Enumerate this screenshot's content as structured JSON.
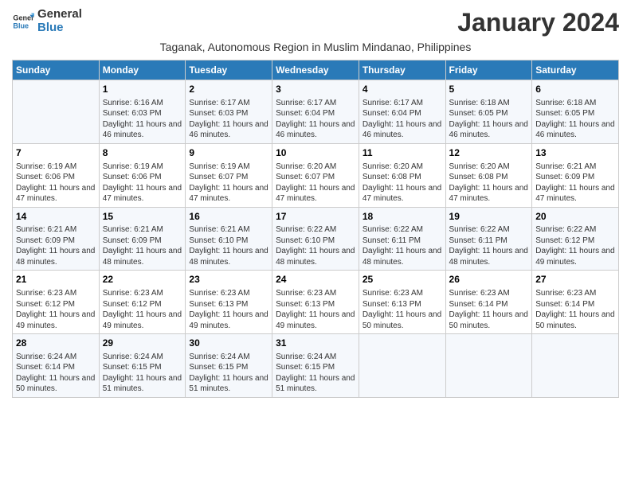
{
  "logo": {
    "line1": "General",
    "line2": "Blue"
  },
  "month_title": "January 2024",
  "subtitle": "Taganak, Autonomous Region in Muslim Mindanao, Philippines",
  "days_of_week": [
    "Sunday",
    "Monday",
    "Tuesday",
    "Wednesday",
    "Thursday",
    "Friday",
    "Saturday"
  ],
  "weeks": [
    [
      {
        "day": "",
        "info": ""
      },
      {
        "day": "1",
        "info": "Sunrise: 6:16 AM\nSunset: 6:03 PM\nDaylight: 11 hours and 46 minutes."
      },
      {
        "day": "2",
        "info": "Sunrise: 6:17 AM\nSunset: 6:03 PM\nDaylight: 11 hours and 46 minutes."
      },
      {
        "day": "3",
        "info": "Sunrise: 6:17 AM\nSunset: 6:04 PM\nDaylight: 11 hours and 46 minutes."
      },
      {
        "day": "4",
        "info": "Sunrise: 6:17 AM\nSunset: 6:04 PM\nDaylight: 11 hours and 46 minutes."
      },
      {
        "day": "5",
        "info": "Sunrise: 6:18 AM\nSunset: 6:05 PM\nDaylight: 11 hours and 46 minutes."
      },
      {
        "day": "6",
        "info": "Sunrise: 6:18 AM\nSunset: 6:05 PM\nDaylight: 11 hours and 46 minutes."
      }
    ],
    [
      {
        "day": "7",
        "info": "Sunrise: 6:19 AM\nSunset: 6:06 PM\nDaylight: 11 hours and 47 minutes."
      },
      {
        "day": "8",
        "info": "Sunrise: 6:19 AM\nSunset: 6:06 PM\nDaylight: 11 hours and 47 minutes."
      },
      {
        "day": "9",
        "info": "Sunrise: 6:19 AM\nSunset: 6:07 PM\nDaylight: 11 hours and 47 minutes."
      },
      {
        "day": "10",
        "info": "Sunrise: 6:20 AM\nSunset: 6:07 PM\nDaylight: 11 hours and 47 minutes."
      },
      {
        "day": "11",
        "info": "Sunrise: 6:20 AM\nSunset: 6:08 PM\nDaylight: 11 hours and 47 minutes."
      },
      {
        "day": "12",
        "info": "Sunrise: 6:20 AM\nSunset: 6:08 PM\nDaylight: 11 hours and 47 minutes."
      },
      {
        "day": "13",
        "info": "Sunrise: 6:21 AM\nSunset: 6:09 PM\nDaylight: 11 hours and 47 minutes."
      }
    ],
    [
      {
        "day": "14",
        "info": "Sunrise: 6:21 AM\nSunset: 6:09 PM\nDaylight: 11 hours and 48 minutes."
      },
      {
        "day": "15",
        "info": "Sunrise: 6:21 AM\nSunset: 6:09 PM\nDaylight: 11 hours and 48 minutes."
      },
      {
        "day": "16",
        "info": "Sunrise: 6:21 AM\nSunset: 6:10 PM\nDaylight: 11 hours and 48 minutes."
      },
      {
        "day": "17",
        "info": "Sunrise: 6:22 AM\nSunset: 6:10 PM\nDaylight: 11 hours and 48 minutes."
      },
      {
        "day": "18",
        "info": "Sunrise: 6:22 AM\nSunset: 6:11 PM\nDaylight: 11 hours and 48 minutes."
      },
      {
        "day": "19",
        "info": "Sunrise: 6:22 AM\nSunset: 6:11 PM\nDaylight: 11 hours and 48 minutes."
      },
      {
        "day": "20",
        "info": "Sunrise: 6:22 AM\nSunset: 6:12 PM\nDaylight: 11 hours and 49 minutes."
      }
    ],
    [
      {
        "day": "21",
        "info": "Sunrise: 6:23 AM\nSunset: 6:12 PM\nDaylight: 11 hours and 49 minutes."
      },
      {
        "day": "22",
        "info": "Sunrise: 6:23 AM\nSunset: 6:12 PM\nDaylight: 11 hours and 49 minutes."
      },
      {
        "day": "23",
        "info": "Sunrise: 6:23 AM\nSunset: 6:13 PM\nDaylight: 11 hours and 49 minutes."
      },
      {
        "day": "24",
        "info": "Sunrise: 6:23 AM\nSunset: 6:13 PM\nDaylight: 11 hours and 49 minutes."
      },
      {
        "day": "25",
        "info": "Sunrise: 6:23 AM\nSunset: 6:13 PM\nDaylight: 11 hours and 50 minutes."
      },
      {
        "day": "26",
        "info": "Sunrise: 6:23 AM\nSunset: 6:14 PM\nDaylight: 11 hours and 50 minutes."
      },
      {
        "day": "27",
        "info": "Sunrise: 6:23 AM\nSunset: 6:14 PM\nDaylight: 11 hours and 50 minutes."
      }
    ],
    [
      {
        "day": "28",
        "info": "Sunrise: 6:24 AM\nSunset: 6:14 PM\nDaylight: 11 hours and 50 minutes."
      },
      {
        "day": "29",
        "info": "Sunrise: 6:24 AM\nSunset: 6:15 PM\nDaylight: 11 hours and 51 minutes."
      },
      {
        "day": "30",
        "info": "Sunrise: 6:24 AM\nSunset: 6:15 PM\nDaylight: 11 hours and 51 minutes."
      },
      {
        "day": "31",
        "info": "Sunrise: 6:24 AM\nSunset: 6:15 PM\nDaylight: 11 hours and 51 minutes."
      },
      {
        "day": "",
        "info": ""
      },
      {
        "day": "",
        "info": ""
      },
      {
        "day": "",
        "info": ""
      }
    ]
  ]
}
